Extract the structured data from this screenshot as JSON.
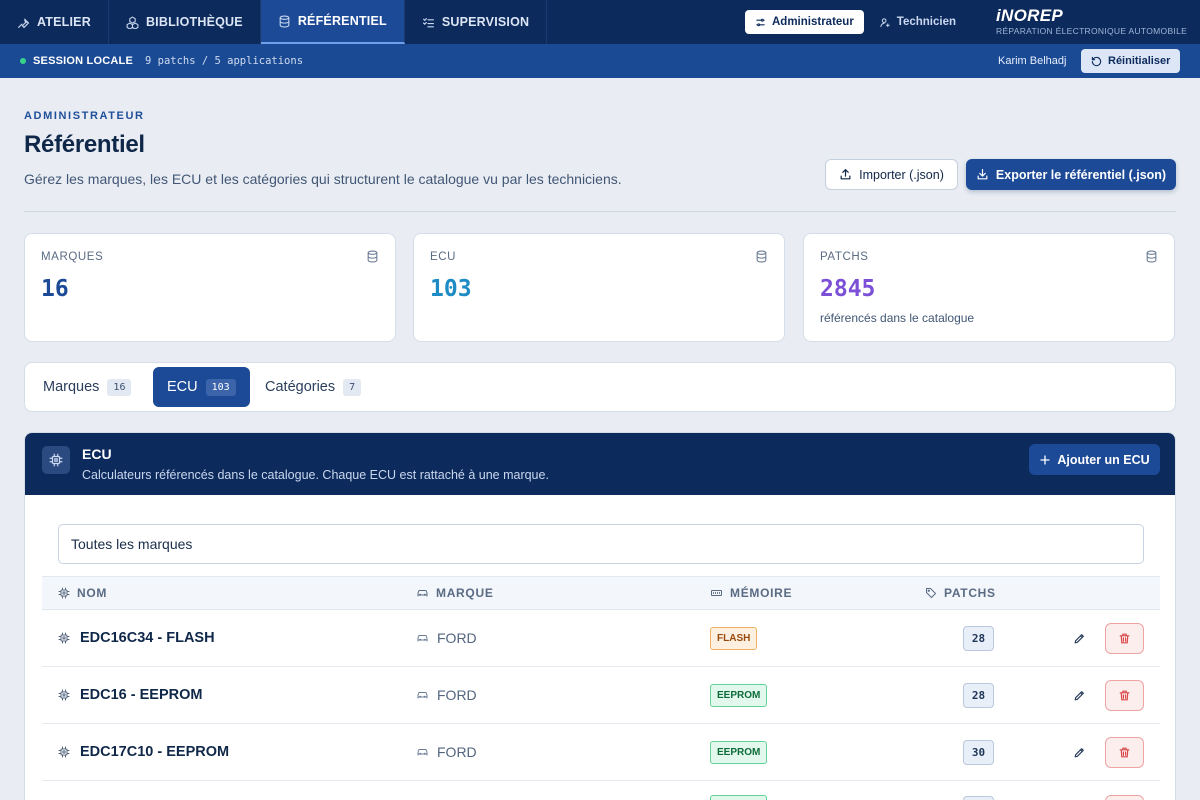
{
  "nav": {
    "tabs": [
      {
        "label": "ATELIER",
        "icon": "wrench-icon"
      },
      {
        "label": "BIBLIOTHÈQUE",
        "icon": "cubes-icon"
      },
      {
        "label": "RÉFÉRENTIEL",
        "icon": "database-icon",
        "active": true
      },
      {
        "label": "SUPERVISION",
        "icon": "checklist-icon"
      }
    ],
    "roles": {
      "admin": "Administrateur",
      "tech": "Technicien",
      "active": "admin"
    },
    "brand": {
      "name": "iNOREP",
      "tagline": "RÉPARATION ÉLECTRONIQUE AUTOMOBILE"
    }
  },
  "session": {
    "label": "SESSION LOCALE",
    "info": "9 patchs / 5 applications",
    "user": "Karim Belhadj",
    "reset_label": "Réinitialiser"
  },
  "header": {
    "eyebrow": "ADMINISTRATEUR",
    "title": "Référentiel",
    "subtitle": "Gérez les marques, les ECU et les catégories qui structurent le catalogue vu par les techniciens.",
    "import_label": "Importer (.json)",
    "export_label": "Exporter le référentiel (.json)"
  },
  "stats": [
    {
      "label": "MARQUES",
      "value": "16",
      "caption": "",
      "color": "#1c4a97"
    },
    {
      "label": "ECU",
      "value": "103",
      "caption": "",
      "color": "#1d8bc4"
    },
    {
      "label": "PATCHS",
      "value": "2845",
      "caption": "référencés dans le catalogue",
      "color": "#7b4fd6"
    }
  ],
  "tabs": [
    {
      "label": "Marques",
      "count": "16"
    },
    {
      "label": "ECU",
      "count": "103",
      "active": true
    },
    {
      "label": "Catégories",
      "count": "7"
    }
  ],
  "panel": {
    "title": "ECU",
    "description": "Calculateurs référencés dans le catalogue. Chaque ECU est rattaché à une marque.",
    "add_label": "Ajouter un ECU",
    "filter_value": "Toutes les marques"
  },
  "table": {
    "columns": {
      "name": "NOM",
      "brand": "MARQUE",
      "memory": "MÉMOIRE",
      "patchs": "PATCHS"
    },
    "rows": [
      {
        "name": "EDC16C34 - FLASH",
        "brand": "FORD",
        "memory": "FLASH",
        "patchs": "28"
      },
      {
        "name": "EDC16 - EEPROM",
        "brand": "FORD",
        "memory": "EEPROM",
        "patchs": "28"
      },
      {
        "name": "EDC17C10 - EEPROM",
        "brand": "FORD",
        "memory": "EEPROM",
        "patchs": "30"
      }
    ]
  },
  "colors": {
    "nav": "#0d2a5c",
    "accent": "#1c4a97",
    "flash": "#f0b25f",
    "eeprom": "#62d398",
    "danger": "#d94848"
  }
}
